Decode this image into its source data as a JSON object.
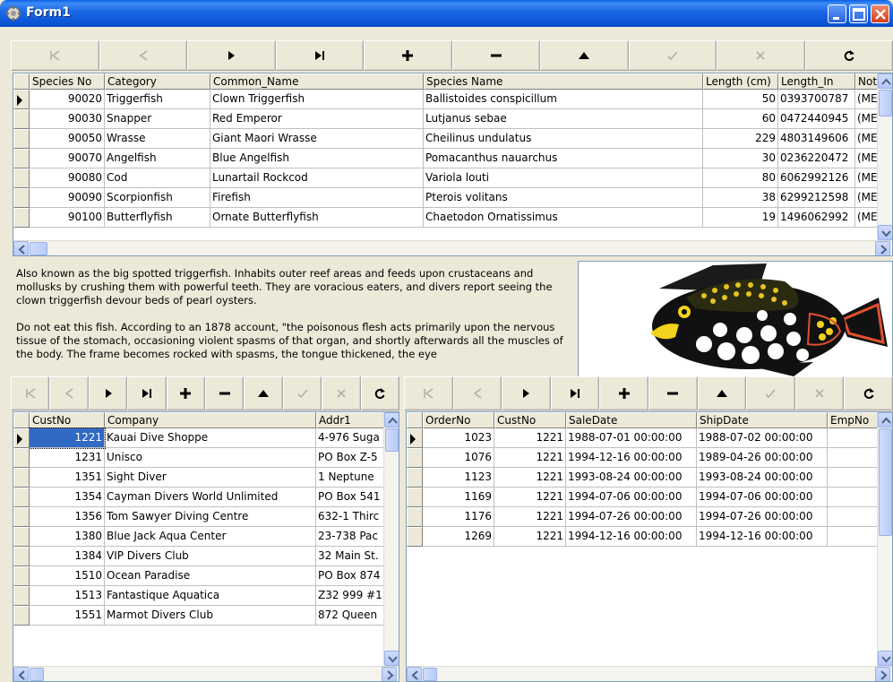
{
  "window": {
    "title": "Form1"
  },
  "colors": {
    "titlebar": "#0a5fe6",
    "selection": "#316ac5"
  },
  "top_navigator": {
    "buttons": [
      "first-icon",
      "prior-icon",
      "next-icon",
      "last-icon",
      "insert-icon",
      "delete-icon",
      "edit-icon",
      "post-icon",
      "cancel-icon",
      "refresh-icon"
    ]
  },
  "species_grid": {
    "columns": [
      "Species No",
      "Category",
      "Common_Name",
      "Species Name",
      "Length (cm)",
      "Length_In",
      "Note"
    ],
    "rows": [
      [
        "90020",
        "Triggerfish",
        "Clown Triggerfish",
        "Ballistoides conspicillum",
        "50",
        "0393700787",
        "(MEI"
      ],
      [
        "90030",
        "Snapper",
        "Red Emperor",
        "Lutjanus sebae",
        "60",
        "0472440945",
        "(MEI"
      ],
      [
        "90050",
        "Wrasse",
        "Giant Maori Wrasse",
        "Cheilinus undulatus",
        "229",
        "4803149606",
        "(MEI"
      ],
      [
        "90070",
        "Angelfish",
        "Blue Angelfish",
        "Pomacanthus nauarchus",
        "30",
        "0236220472",
        "(MEI"
      ],
      [
        "90080",
        "Cod",
        "Lunartail Rockcod",
        "Variola louti",
        "80",
        "6062992126",
        "(MEI"
      ],
      [
        "90090",
        "Scorpionfish",
        "Firefish",
        "Pterois volitans",
        "38",
        "6299212598",
        "(MEI"
      ],
      [
        "90100",
        "Butterflyfish",
        "Ornate Butterflyfish",
        "Chaetodon Ornatissimus",
        "19",
        "1496062992",
        "(MEI"
      ]
    ]
  },
  "memo": {
    "paragraphs": [
      "Also known as the big spotted triggerfish.  Inhabits outer reef areas and feeds upon crustaceans and mollusks by crushing them with powerful teeth.  They are voracious eaters, and divers report seeing the clown triggerfish devour beds of pearl oysters.",
      "Do not eat this fish.  According to an 1878 account, \"the poisonous flesh acts primarily upon the nervous tissue of the stomach, occasioning violent spasms of that organ, and shortly afterwards all the muscles of the body.  The frame becomes rocked with spasms, the tongue thickened, the eye"
    ]
  },
  "customers_grid": {
    "columns": [
      "CustNo",
      "Company",
      "Addr1"
    ],
    "rows": [
      [
        "1221",
        "Kauai Dive Shoppe",
        "4-976 Suga"
      ],
      [
        "1231",
        "Unisco",
        "PO Box Z-5"
      ],
      [
        "1351",
        "Sight Diver",
        "1 Neptune"
      ],
      [
        "1354",
        "Cayman Divers World Unlimited",
        "PO Box 541"
      ],
      [
        "1356",
        "Tom Sawyer Diving Centre",
        "632-1 Thirc"
      ],
      [
        "1380",
        "Blue Jack Aqua Center",
        "23-738 Pac"
      ],
      [
        "1384",
        "VIP Divers Club",
        "32 Main St."
      ],
      [
        "1510",
        "Ocean Paradise",
        "PO Box 874"
      ],
      [
        "1513",
        "Fantastique Aquatica",
        "Z32 999 #1"
      ],
      [
        "1551",
        "Marmot Divers Club",
        "872 Queen"
      ]
    ]
  },
  "orders_grid": {
    "columns": [
      "OrderNo",
      "CustNo",
      "SaleDate",
      "ShipDate",
      "EmpNo"
    ],
    "rows": [
      [
        "1023",
        "1221",
        "1988-07-01 00:00:00",
        "1988-07-02 00:00:00",
        ""
      ],
      [
        "1076",
        "1221",
        "1994-12-16 00:00:00",
        "1989-04-26 00:00:00",
        ""
      ],
      [
        "1123",
        "1221",
        "1993-08-24 00:00:00",
        "1993-08-24 00:00:00",
        ""
      ],
      [
        "1169",
        "1221",
        "1994-07-06 00:00:00",
        "1994-07-06 00:00:00",
        ""
      ],
      [
        "1176",
        "1221",
        "1994-07-26 00:00:00",
        "1994-07-26 00:00:00",
        ""
      ],
      [
        "1269",
        "1221",
        "1994-12-16 00:00:00",
        "1994-12-16 00:00:00",
        ""
      ]
    ]
  }
}
